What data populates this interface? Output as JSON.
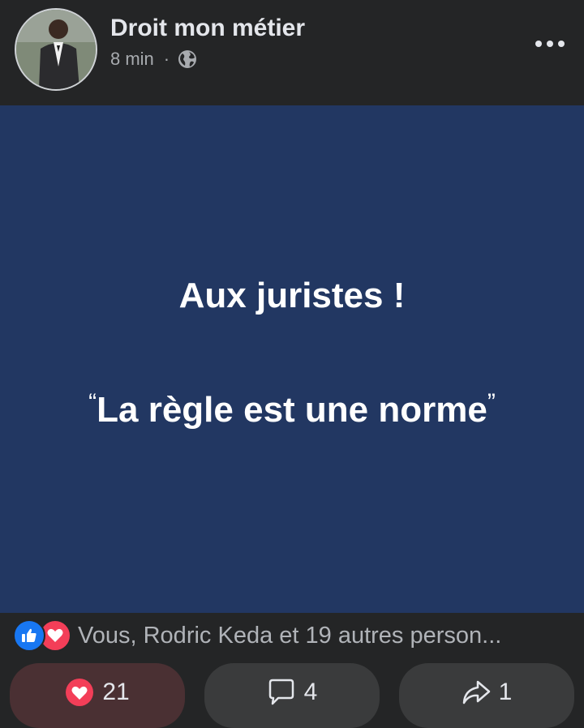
{
  "post": {
    "page_name": "Droit mon métier",
    "time": "8 min",
    "separator": "·",
    "privacy_icon": "globe-icon",
    "more_icon": "more-dots-icon"
  },
  "image": {
    "headline": "Aux juristes !",
    "quote_open": "“",
    "quote_text": "La règle est une norme",
    "quote_close": "”",
    "background_color": "#223762"
  },
  "reactions": {
    "icons": [
      "like-icon",
      "love-icon"
    ],
    "summary": "Vous, Rodric Keda et 19 autres person..."
  },
  "actions": [
    {
      "icon": "heart-icon",
      "count": "21"
    },
    {
      "icon": "comment-icon",
      "count": "4"
    },
    {
      "icon": "share-icon",
      "count": "1"
    }
  ],
  "colors": {
    "background": "#242526",
    "like_blue": "#1877f2",
    "love_red": "#f33e58"
  }
}
